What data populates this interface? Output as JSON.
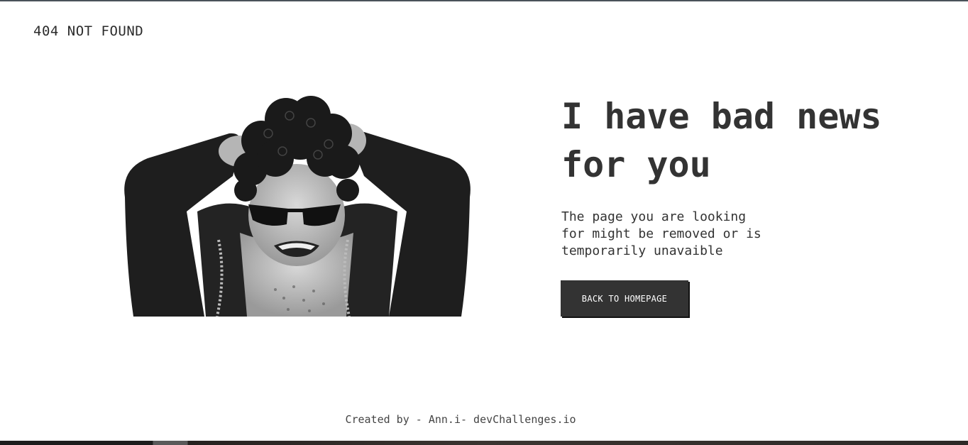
{
  "brand": {
    "label": "404 NOT FOUND"
  },
  "hero": {
    "headline": "I have bad news for you",
    "message": "The page you are looking\nfor might be removed or is\ntemporarily unavaible",
    "button_label": "BACK TO HOMEPAGE"
  },
  "illustration": {
    "icon": "stressed-man-illustration"
  },
  "footer": {
    "credit": "Created by - Ann.i- devChallenges.io"
  },
  "colors": {
    "text": "#333333",
    "button_bg": "#333333",
    "button_text": "#ffffff",
    "background": "#ffffff"
  }
}
